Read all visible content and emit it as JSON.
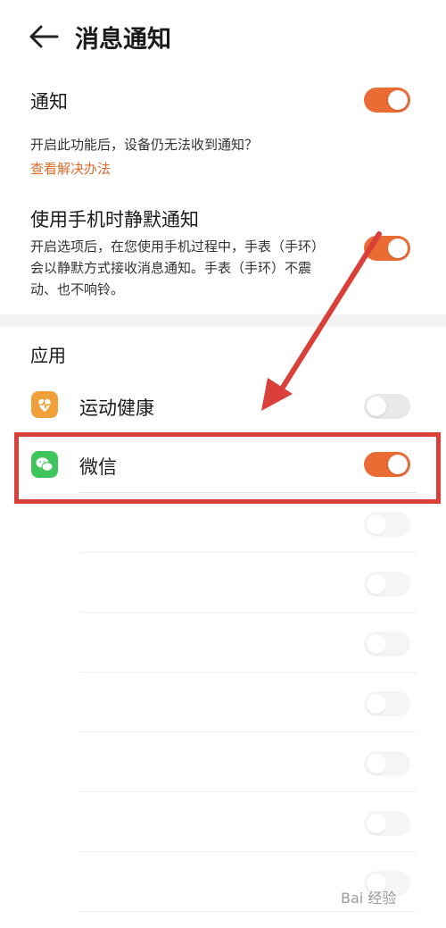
{
  "header": {
    "title": "消息通知"
  },
  "notify": {
    "label": "通知",
    "enabled": true
  },
  "notify_help": {
    "question": "开启此功能后，设备仍无法收到通知？",
    "link": "查看解决办法"
  },
  "silent": {
    "label": "使用手机时静默通知",
    "desc1": "开启选项后，在您使用手机过程中，手表（手环）",
    "desc2": "会以静默方式接收消息通知。手表（手环）不震",
    "desc3": "动、也不响铃。",
    "enabled": true
  },
  "apps_section": {
    "title": "应用"
  },
  "apps": [
    {
      "name": "运动健康",
      "enabled": false,
      "icon": "health-app-icon"
    },
    {
      "name": "微信",
      "enabled": true,
      "icon": "wechat-app-icon"
    }
  ],
  "blurred_rows_count": 7,
  "watermark": "Bai 经验",
  "colors": {
    "accent": "#ea6b33",
    "link": "#e06a2a",
    "highlight": "#d9403a",
    "health_icon": "#f0a03a",
    "wechat_icon": "#3fc55b"
  }
}
